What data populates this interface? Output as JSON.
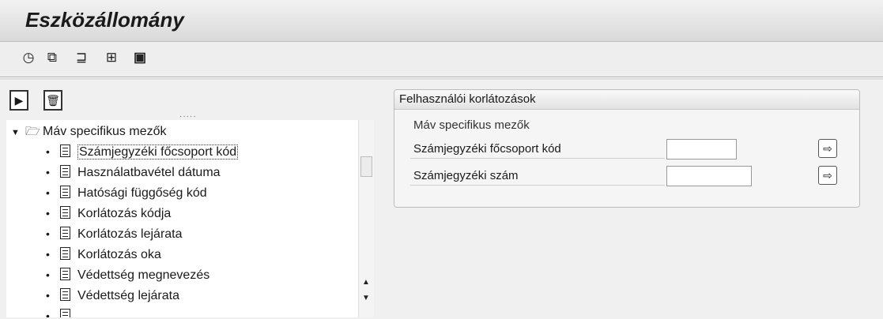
{
  "window": {
    "title": "Eszközállomány"
  },
  "toolbar": {
    "icons": [
      "execute-clock-icon",
      "copy-icon",
      "columns-icon",
      "multiple-selection-icon",
      "information-icon"
    ]
  },
  "tree": {
    "root_label": "Máv specifikus mezők",
    "items": [
      {
        "label": "Számjegyzéki főcsoport kód",
        "selected": true
      },
      {
        "label": "Használatbavétel dátuma"
      },
      {
        "label": "Hatósági függőség kód"
      },
      {
        "label": "Korlátozás kódja"
      },
      {
        "label": "Korlátozás lejárata"
      },
      {
        "label": "Korlátozás oka"
      },
      {
        "label": "Védettség megnevezés"
      },
      {
        "label": "Védettség lejárata"
      }
    ]
  },
  "panel": {
    "title": "Felhasználói korlátozások",
    "group_label": "Máv specifikus mezők",
    "fields": [
      {
        "label": "Számjegyzéki főcsoport kód",
        "value": ""
      },
      {
        "label": "Számjegyzéki szám",
        "value": ""
      }
    ]
  }
}
